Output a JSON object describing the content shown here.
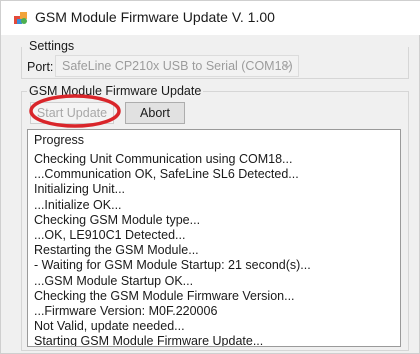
{
  "window": {
    "title": "GSM Module Firmware Update V. 1.00"
  },
  "settings": {
    "group_label": "Settings",
    "port_label": "Port:",
    "port_value": "SafeLine CP210x USB to Serial (COM18)"
  },
  "firmware_update": {
    "group_label": "GSM Module Firmware Update",
    "start_button_label": "Start Update",
    "abort_button_label": "Abort"
  },
  "progress": {
    "header": "Progress",
    "lines": [
      "Checking Unit Communication using COM18...",
      "...Communication OK, SafeLine SL6 Detected...",
      "Initializing Unit...",
      "...Initialize OK...",
      "Checking GSM Module type...",
      "...OK, LE910C1 Detected...",
      "Restarting the GSM Module...",
      "- Waiting for GSM Module Startup: 21 second(s)...",
      "...GSM Module Startup OK...",
      "Checking the GSM Module Firmware Version...",
      "...Firmware Version: M0F.220006",
      "Not Valid, update needed...",
      "Starting GSM Module Firmware Update..."
    ]
  },
  "colors": {
    "highlight": "#d9252a",
    "disabled_text": "#a8a8a8",
    "window_bg": "#f0f0f0"
  },
  "icons": {
    "app": "app-puzzle-icon",
    "combo": "chevron-down-icon"
  }
}
